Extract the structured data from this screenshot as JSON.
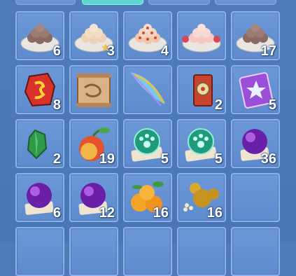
{
  "inventory": {
    "rows": [
      [
        {
          "icon": "meatball-plate-icon",
          "count": "6"
        },
        {
          "icon": "dumpling-plate-icon",
          "count": "3"
        },
        {
          "icon": "dumpling-plate-red-icon",
          "count": "4"
        },
        {
          "icon": "rose-dumpling-plate-icon",
          "count": ""
        },
        {
          "icon": "meatball-plate-icon",
          "count": "17"
        }
      ],
      [
        {
          "icon": "red-rune-stone-icon",
          "count": "8"
        },
        {
          "icon": "treasure-map-scroll-icon",
          "count": ""
        },
        {
          "icon": "rainbow-feather-icon",
          "count": ""
        },
        {
          "icon": "seal-scroll-icon",
          "count": "2"
        },
        {
          "icon": "purple-star-ticket-icon",
          "count": "5"
        }
      ],
      [
        {
          "icon": "green-crystal-icon",
          "count": "2"
        },
        {
          "icon": "peach-fruit-icon",
          "count": "19"
        },
        {
          "icon": "jade-paw-orb-icon",
          "count": "5"
        },
        {
          "icon": "jade-paw-orb-icon",
          "count": "5"
        },
        {
          "icon": "purple-orb-icon",
          "count": "36"
        }
      ],
      [
        {
          "icon": "purple-orb-icon",
          "count": "6"
        },
        {
          "icon": "purple-orb-icon",
          "count": "12"
        },
        {
          "icon": "orange-fruit-icon",
          "count": "16"
        },
        {
          "icon": "golden-gourd-icon",
          "count": "16"
        },
        {
          "icon": "empty-slot",
          "count": ""
        }
      ]
    ]
  }
}
